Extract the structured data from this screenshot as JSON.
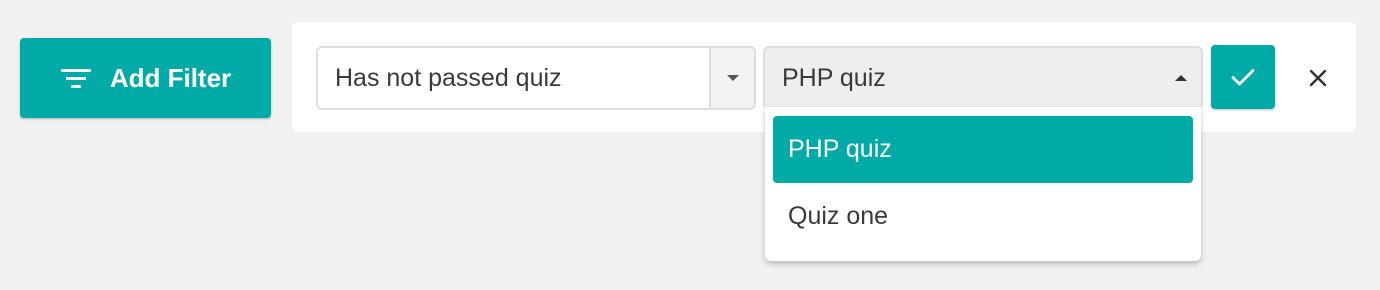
{
  "toolbar": {
    "add_filter_label": "Add Filter"
  },
  "filter": {
    "condition": {
      "value": "Has not passed quiz"
    },
    "quiz": {
      "value": "PHP quiz",
      "options": [
        "PHP quiz",
        "Quiz one"
      ],
      "selected_index": 0
    }
  },
  "icons": {
    "add_filter": "filter-icon",
    "condition_arrow": "chevron-down-icon",
    "quiz_arrow": "chevron-up-icon",
    "confirm": "check-icon",
    "remove": "close-icon"
  },
  "colors": {
    "accent": "#00aaa6",
    "background": "#f1f1f1",
    "panel": "#ffffff"
  }
}
